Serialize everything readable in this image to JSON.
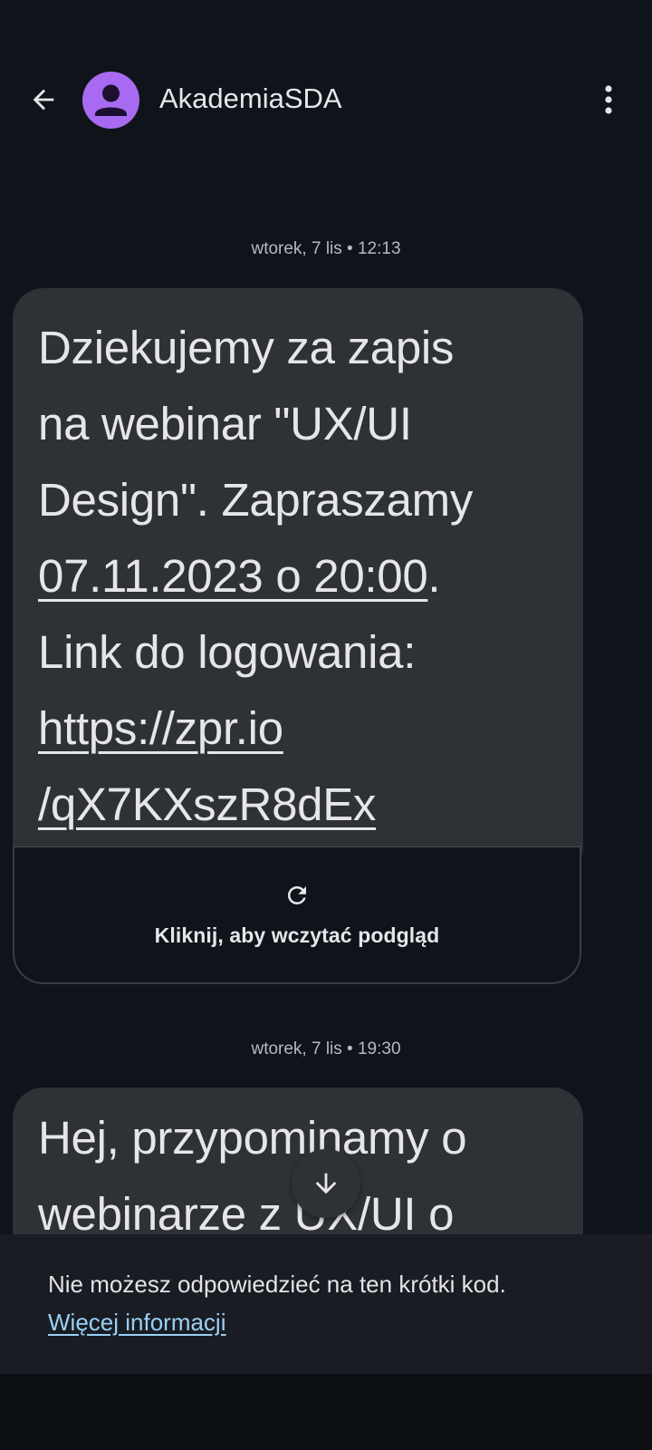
{
  "header": {
    "sender_name": "AkademiaSDA",
    "avatar_color": "#a86af0",
    "back_icon": "arrow-left-icon",
    "menu_icon": "more-vert-icon"
  },
  "messages": [
    {
      "timestamp": "wtorek, 7 lis • 12:13",
      "lines": [
        "Dziekujemy za zapis",
        "na webinar \"UX/UI",
        "Design\". Zapraszamy"
      ],
      "date_link": "07.11.2023 o 20:00",
      "date_suffix": ".",
      "line_after_date": "Link do logowania:",
      "url_part1": "https://zpr.io",
      "url_part2": "/qX7KXszR8dEx",
      "preview_label": "Kliknij, aby wczytać podgląd",
      "preview_icon": "refresh-icon"
    },
    {
      "timestamp": "wtorek, 7 lis • 19:30",
      "lines": [
        "Hej, przypominamy o",
        "webinarze z UX/UI o"
      ]
    }
  ],
  "scroll_button_icon": "arrow-down-icon",
  "notice": {
    "text": "Nie możesz odpowiedzieć na ten krótki kod.",
    "link": "Więcej informacji",
    "link_color": "#9ad0f5"
  }
}
